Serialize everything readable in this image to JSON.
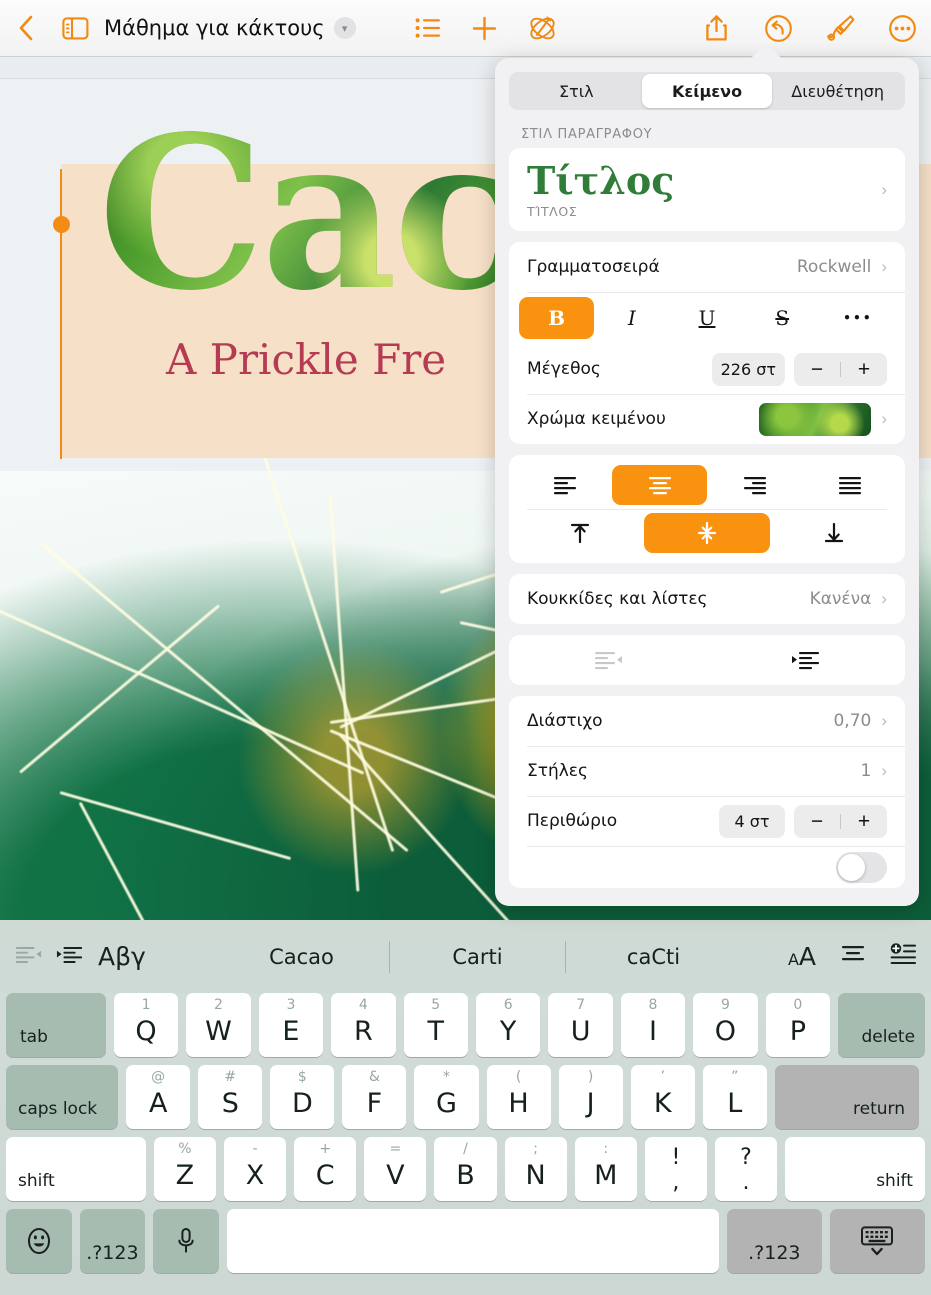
{
  "toolbar": {
    "back_icon": "chevron-left-icon",
    "sidebar_icon": "sidebar-toggle-icon",
    "title": "Μάθημα για κάκτους",
    "title_chevron": "chevron-down-icon",
    "list_icon": "list-view-icon",
    "add_icon": "plus-icon",
    "intelligence_icon": "apple-intelligence-icon",
    "share_icon": "share-icon",
    "undo_icon": "undo-icon",
    "format_icon": "paintbrush-icon",
    "more_icon": "more-ellipsis-icon",
    "document_icon": "document-options-icon"
  },
  "document": {
    "title_text": "Cac",
    "subtitle_text": "A Prickle Fre",
    "title_color_fill": "#4e9e2e",
    "subtitle_color": "#b53b52",
    "band_color": "#f6e0c8",
    "selection_handle_color": "#f58b17"
  },
  "panel": {
    "tabs": [
      {
        "label": "Στιλ",
        "active": false
      },
      {
        "label": "Κείμενο",
        "active": true
      },
      {
        "label": "Διευθέτηση",
        "active": false
      }
    ],
    "paragraph_styles_label": "ΣΤΙΛ ΠΑΡΑΓΡΑΦΟΥ",
    "style_preview": {
      "name": "Τίτλος",
      "caption": "ΤΊΤΛΟΣ",
      "color": "#2f7d38"
    },
    "font": {
      "label": "Γραμματοσειρά",
      "value": "Rockwell"
    },
    "emphasis": [
      {
        "label": "B",
        "name": "bold",
        "active": true
      },
      {
        "label": "I",
        "name": "italic",
        "active": false
      },
      {
        "label": "U",
        "name": "underline",
        "active": false
      },
      {
        "label": "S",
        "name": "strikethrough",
        "active": false
      },
      {
        "label": "•••",
        "name": "more-text-options",
        "active": false
      }
    ],
    "size": {
      "label": "Μέγεθος",
      "value": "226 στ",
      "minus": "−",
      "plus": "+"
    },
    "text_color": {
      "label": "Χρώμα κειμένου"
    },
    "align_horizontal": [
      {
        "name": "align-left",
        "active": false
      },
      {
        "name": "align-center",
        "active": true
      },
      {
        "name": "align-right",
        "active": false
      },
      {
        "name": "align-justify",
        "active": false
      }
    ],
    "align_vertical": [
      {
        "name": "align-top",
        "active": false
      },
      {
        "name": "align-middle",
        "active": true
      },
      {
        "name": "align-bottom",
        "active": false
      }
    ],
    "bullets": {
      "label": "Κουκκίδες και λίστες",
      "value": "Κανένα"
    },
    "indent": [
      {
        "name": "outdent",
        "enabled": false
      },
      {
        "name": "indent",
        "enabled": true
      }
    ],
    "line_spacing": {
      "label": "Διάστιχο",
      "value": "0,70"
    },
    "columns": {
      "label": "Στήλες",
      "value": "1"
    },
    "margin": {
      "label": "Περιθώριο",
      "value": "4 στ",
      "minus": "−",
      "plus": "+"
    },
    "accent_color": "#f8920f"
  },
  "keyboard": {
    "suggestion_bar": {
      "outdent_icon": "outdent-icon",
      "indent_icon": "indent-icon",
      "language_label": "Αβγ",
      "suggestions": [
        "Cacao",
        "Carti",
        "caCti"
      ],
      "text_size_icon": "text-size-icon",
      "align_icon": "align-center-icon",
      "insert_icon": "insert-list-icon"
    },
    "row1_left": "tab",
    "row1_right": "delete",
    "row1": [
      {
        "main": "Q",
        "alt": "1"
      },
      {
        "main": "W",
        "alt": "2"
      },
      {
        "main": "E",
        "alt": "3"
      },
      {
        "main": "R",
        "alt": "4"
      },
      {
        "main": "T",
        "alt": "5"
      },
      {
        "main": "Y",
        "alt": "6"
      },
      {
        "main": "U",
        "alt": "7"
      },
      {
        "main": "I",
        "alt": "8"
      },
      {
        "main": "O",
        "alt": "9"
      },
      {
        "main": "P",
        "alt": "0"
      }
    ],
    "row2_left": "caps lock",
    "row2_right": "return",
    "row2": [
      {
        "main": "A",
        "alt": "@"
      },
      {
        "main": "S",
        "alt": "#"
      },
      {
        "main": "D",
        "alt": "$"
      },
      {
        "main": "F",
        "alt": "&"
      },
      {
        "main": "G",
        "alt": "*"
      },
      {
        "main": "H",
        "alt": "("
      },
      {
        "main": "J",
        "alt": ")"
      },
      {
        "main": "K",
        "alt": "’"
      },
      {
        "main": "L",
        "alt": "”"
      }
    ],
    "row3_left": "shift",
    "row3_right": "shift",
    "row3": [
      {
        "main": "Z",
        "alt": "%"
      },
      {
        "main": "X",
        "alt": "-"
      },
      {
        "main": "C",
        "alt": "+"
      },
      {
        "main": "V",
        "alt": "="
      },
      {
        "main": "B",
        "alt": "/"
      },
      {
        "main": "N",
        "alt": ";"
      },
      {
        "main": "M",
        "alt": ":"
      },
      {
        "top": "!",
        "bottom": ","
      },
      {
        "top": "?",
        "bottom": "."
      }
    ],
    "bottom": {
      "emoji": "☺",
      "numbers_left": ".?123",
      "mic": "mic-icon",
      "space": "",
      "numbers_right": ".?123",
      "dismiss": "dismiss-keyboard-icon"
    }
  }
}
